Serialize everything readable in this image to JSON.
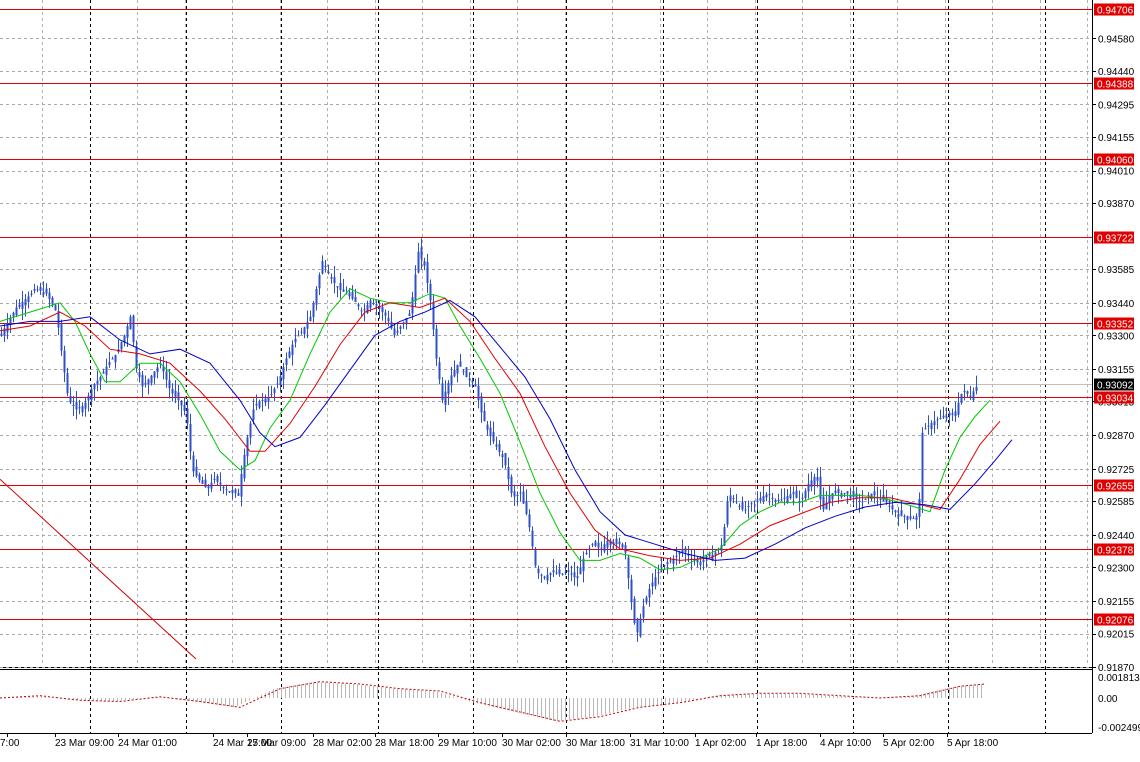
{
  "chart_data": {
    "type": "candlestick",
    "main_panel": {
      "ylim": [
        0.91875,
        0.94745
      ],
      "price_ticks": [
        "0.94580",
        "0.94440",
        "0.94295",
        "0.94155",
        "0.94010",
        "0.93870",
        "0.93585",
        "0.93440",
        "0.93300",
        "0.93155",
        "0.93015",
        "0.92870",
        "0.92725",
        "0.92585",
        "0.92440",
        "0.92300",
        "0.92155",
        "0.92015",
        "0.91870"
      ],
      "horizontal_levels": [
        {
          "value": 0.94706,
          "label": "0.94706"
        },
        {
          "value": 0.94388,
          "label": "0.94388"
        },
        {
          "value": 0.9406,
          "label": "0.94060"
        },
        {
          "value": 0.93722,
          "label": "0.93722"
        },
        {
          "value": 0.93352,
          "label": "0.93352"
        },
        {
          "value": 0.93034,
          "label": "0.93034"
        },
        {
          "value": 0.92655,
          "label": "0.92655"
        },
        {
          "value": 0.92378,
          "label": "0.92378"
        },
        {
          "value": 0.92076,
          "label": "0.92076"
        }
      ],
      "current_price": {
        "value": 0.93092,
        "label": "0.93092"
      },
      "close_path": [
        [
          0,
          0.933
        ],
        [
          8,
          0.9336
        ],
        [
          16,
          0.9342
        ],
        [
          26,
          0.9346
        ],
        [
          36,
          0.935
        ],
        [
          46,
          0.9348
        ],
        [
          56,
          0.934
        ],
        [
          62,
          0.932
        ],
        [
          68,
          0.9302
        ],
        [
          76,
          0.9298
        ],
        [
          84,
          0.93
        ],
        [
          92,
          0.9308
        ],
        [
          100,
          0.9312
        ],
        [
          108,
          0.9318
        ],
        [
          116,
          0.9322
        ],
        [
          124,
          0.933
        ],
        [
          130,
          0.9338
        ],
        [
          136,
          0.9316
        ],
        [
          142,
          0.9308
        ],
        [
          150,
          0.9312
        ],
        [
          160,
          0.9318
        ],
        [
          170,
          0.9306
        ],
        [
          178,
          0.9302
        ],
        [
          186,
          0.9296
        ],
        [
          192,
          0.9272
        ],
        [
          198,
          0.9268
        ],
        [
          206,
          0.9264
        ],
        [
          214,
          0.9268
        ],
        [
          222,
          0.9265
        ],
        [
          230,
          0.9262
        ],
        [
          238,
          0.9262
        ],
        [
          246,
          0.9284
        ],
        [
          254,
          0.93
        ],
        [
          262,
          0.9302
        ],
        [
          270,
          0.9304
        ],
        [
          278,
          0.931
        ],
        [
          286,
          0.932
        ],
        [
          294,
          0.9328
        ],
        [
          302,
          0.9332
        ],
        [
          310,
          0.9338
        ],
        [
          316,
          0.935
        ],
        [
          322,
          0.9362
        ],
        [
          330,
          0.9355
        ],
        [
          338,
          0.935
        ],
        [
          346,
          0.9348
        ],
        [
          354,
          0.9345
        ],
        [
          362,
          0.934
        ],
        [
          370,
          0.9345
        ],
        [
          378,
          0.9342
        ],
        [
          386,
          0.9338
        ],
        [
          394,
          0.933
        ],
        [
          402,
          0.9335
        ],
        [
          410,
          0.934
        ],
        [
          418,
          0.9366
        ],
        [
          424,
          0.936
        ],
        [
          430,
          0.9345
        ],
        [
          436,
          0.932
        ],
        [
          442,
          0.9302
        ],
        [
          450,
          0.9312
        ],
        [
          458,
          0.9318
        ],
        [
          466,
          0.9312
        ],
        [
          474,
          0.931
        ],
        [
          480,
          0.9298
        ],
        [
          488,
          0.9288
        ],
        [
          496,
          0.9282
        ],
        [
          504,
          0.9276
        ],
        [
          512,
          0.926
        ],
        [
          520,
          0.9262
        ],
        [
          528,
          0.925
        ],
        [
          536,
          0.9228
        ],
        [
          544,
          0.9226
        ],
        [
          552,
          0.9228
        ],
        [
          560,
          0.9227
        ],
        [
          568,
          0.9228
        ],
        [
          576,
          0.9225
        ],
        [
          584,
          0.9235
        ],
        [
          592,
          0.924
        ],
        [
          600,
          0.9238
        ],
        [
          608,
          0.9242
        ],
        [
          616,
          0.924
        ],
        [
          624,
          0.924
        ],
        [
          630,
          0.9218
        ],
        [
          636,
          0.92
        ],
        [
          642,
          0.9212
        ],
        [
          650,
          0.9222
        ],
        [
          658,
          0.9228
        ],
        [
          666,
          0.9232
        ],
        [
          674,
          0.9234
        ],
        [
          682,
          0.9238
        ],
        [
          690,
          0.9234
        ],
        [
          698,
          0.9232
        ],
        [
          706,
          0.9234
        ],
        [
          714,
          0.9236
        ],
        [
          722,
          0.924
        ],
        [
          728,
          0.9262
        ],
        [
          736,
          0.9258
        ],
        [
          744,
          0.9254
        ],
        [
          752,
          0.9258
        ],
        [
          760,
          0.926
        ],
        [
          768,
          0.9262
        ],
        [
          776,
          0.9258
        ],
        [
          784,
          0.926
        ],
        [
          792,
          0.9262
        ],
        [
          800,
          0.9258
        ],
        [
          808,
          0.9266
        ],
        [
          816,
          0.927
        ],
        [
          822,
          0.9254
        ],
        [
          830,
          0.9262
        ],
        [
          838,
          0.9262
        ],
        [
          846,
          0.9262
        ],
        [
          854,
          0.926
        ],
        [
          862,
          0.9258
        ],
        [
          870,
          0.9262
        ],
        [
          878,
          0.926
        ],
        [
          886,
          0.9258
        ],
        [
          894,
          0.9254
        ],
        [
          902,
          0.9252
        ],
        [
          910,
          0.9252
        ],
        [
          918,
          0.925
        ],
        [
          922,
          0.9288
        ],
        [
          930,
          0.9292
        ],
        [
          938,
          0.9294
        ],
        [
          946,
          0.9295
        ],
        [
          954,
          0.9296
        ],
        [
          962,
          0.9306
        ],
        [
          970,
          0.9304
        ],
        [
          978,
          0.9309
        ]
      ],
      "moving_averages": [
        {
          "color": "#00c800",
          "path": [
            [
              0,
              0.9336
            ],
            [
              30,
              0.934
            ],
            [
              60,
              0.9344
            ],
            [
              75,
              0.9336
            ],
            [
              90,
              0.9322
            ],
            [
              105,
              0.931
            ],
            [
              120,
              0.931
            ],
            [
              140,
              0.9318
            ],
            [
              160,
              0.9318
            ],
            [
              180,
              0.931
            ],
            [
              200,
              0.9296
            ],
            [
              220,
              0.928
            ],
            [
              240,
              0.9272
            ],
            [
              255,
              0.9276
            ],
            [
              270,
              0.929
            ],
            [
              290,
              0.9302
            ],
            [
              310,
              0.9322
            ],
            [
              330,
              0.934
            ],
            [
              350,
              0.935
            ],
            [
              370,
              0.9346
            ],
            [
              390,
              0.9344
            ],
            [
              410,
              0.9344
            ],
            [
              430,
              0.9348
            ],
            [
              445,
              0.9346
            ],
            [
              460,
              0.9334
            ],
            [
              480,
              0.932
            ],
            [
              500,
              0.9305
            ],
            [
              520,
              0.9284
            ],
            [
              540,
              0.9262
            ],
            [
              560,
              0.9245
            ],
            [
              580,
              0.9233
            ],
            [
              600,
              0.9233
            ],
            [
              620,
              0.9236
            ],
            [
              640,
              0.9234
            ],
            [
              660,
              0.9229
            ],
            [
              680,
              0.923
            ],
            [
              700,
              0.9234
            ],
            [
              720,
              0.9238
            ],
            [
              740,
              0.9248
            ],
            [
              760,
              0.9254
            ],
            [
              780,
              0.9258
            ],
            [
              800,
              0.9258
            ],
            [
              820,
              0.9261
            ],
            [
              840,
              0.9261
            ],
            [
              860,
              0.9261
            ],
            [
              880,
              0.926
            ],
            [
              900,
              0.9258
            ],
            [
              915,
              0.9256
            ],
            [
              930,
              0.9254
            ],
            [
              945,
              0.9272
            ],
            [
              960,
              0.9286
            ],
            [
              975,
              0.9295
            ],
            [
              990,
              0.9302
            ]
          ]
        },
        {
          "color": "#e00000",
          "path": [
            [
              0,
              0.9332
            ],
            [
              30,
              0.9334
            ],
            [
              60,
              0.934
            ],
            [
              85,
              0.9334
            ],
            [
              110,
              0.9324
            ],
            [
              140,
              0.9322
            ],
            [
              170,
              0.9318
            ],
            [
              200,
              0.9306
            ],
            [
              225,
              0.9294
            ],
            [
              250,
              0.928
            ],
            [
              265,
              0.928
            ],
            [
              290,
              0.9292
            ],
            [
              315,
              0.9308
            ],
            [
              340,
              0.9326
            ],
            [
              365,
              0.934
            ],
            [
              390,
              0.9344
            ],
            [
              420,
              0.9342
            ],
            [
              445,
              0.9346
            ],
            [
              470,
              0.9336
            ],
            [
              495,
              0.932
            ],
            [
              520,
              0.9305
            ],
            [
              545,
              0.9282
            ],
            [
              570,
              0.9262
            ],
            [
              595,
              0.9246
            ],
            [
              620,
              0.9238
            ],
            [
              650,
              0.9235
            ],
            [
              680,
              0.9233
            ],
            [
              710,
              0.9234
            ],
            [
              740,
              0.924
            ],
            [
              770,
              0.9248
            ],
            [
              800,
              0.9253
            ],
            [
              830,
              0.9258
            ],
            [
              860,
              0.926
            ],
            [
              890,
              0.926
            ],
            [
              920,
              0.9257
            ],
            [
              940,
              0.9255
            ],
            [
              960,
              0.9268
            ],
            [
              980,
              0.9283
            ],
            [
              1000,
              0.9293
            ]
          ]
        },
        {
          "color": "#0000c8",
          "path": [
            [
              0,
              0.9334
            ],
            [
              30,
              0.9336
            ],
            [
              60,
              0.9336
            ],
            [
              90,
              0.9338
            ],
            [
              120,
              0.9328
            ],
            [
              150,
              0.9322
            ],
            [
              180,
              0.9324
            ],
            [
              210,
              0.9318
            ],
            [
              240,
              0.9302
            ],
            [
              260,
              0.9288
            ],
            [
              275,
              0.9282
            ],
            [
              300,
              0.9286
            ],
            [
              325,
              0.93
            ],
            [
              350,
              0.9315
            ],
            [
              375,
              0.933
            ],
            [
              400,
              0.9336
            ],
            [
              425,
              0.934
            ],
            [
              450,
              0.9345
            ],
            [
              475,
              0.9338
            ],
            [
              500,
              0.9325
            ],
            [
              525,
              0.9312
            ],
            [
              550,
              0.9294
            ],
            [
              575,
              0.9272
            ],
            [
              600,
              0.9254
            ],
            [
              625,
              0.9244
            ],
            [
              655,
              0.924
            ],
            [
              685,
              0.9236
            ],
            [
              715,
              0.9233
            ],
            [
              745,
              0.9234
            ],
            [
              775,
              0.924
            ],
            [
              805,
              0.9247
            ],
            [
              835,
              0.9252
            ],
            [
              865,
              0.9256
            ],
            [
              895,
              0.9258
            ],
            [
              925,
              0.9257
            ],
            [
              950,
              0.9255
            ],
            [
              975,
              0.9266
            ],
            [
              995,
              0.9276
            ],
            [
              1012,
              0.9285
            ]
          ]
        }
      ],
      "trendline": {
        "color": "#d00000",
        "from": [
          0,
          0.9268
        ],
        "to": [
          196,
          0.91905
        ]
      }
    },
    "oscillator": {
      "ylim": [
        -0.003,
        0.0024
      ],
      "ticks": [
        "0.001813",
        "0.00",
        "-0.002499"
      ],
      "signal_path": [
        [
          0,
          0.0
        ],
        [
          40,
          0.0002
        ],
        [
          80,
          -0.0002
        ],
        [
          120,
          -0.0003
        ],
        [
          160,
          0.0001
        ],
        [
          200,
          -0.0003
        ],
        [
          240,
          -0.0008
        ],
        [
          280,
          0.0008
        ],
        [
          320,
          0.0014
        ],
        [
          360,
          0.0012
        ],
        [
          400,
          0.0008
        ],
        [
          440,
          0.0006
        ],
        [
          480,
          -0.0004
        ],
        [
          520,
          -0.0012
        ],
        [
          560,
          -0.002
        ],
        [
          600,
          -0.0016
        ],
        [
          640,
          -0.0008
        ],
        [
          680,
          -0.0004
        ],
        [
          720,
          0.0002
        ],
        [
          760,
          0.0004
        ],
        [
          800,
          0.0004
        ],
        [
          840,
          0.0002
        ],
        [
          880,
          0.0
        ],
        [
          920,
          0.0002
        ],
        [
          960,
          0.001
        ],
        [
          985,
          0.0012
        ]
      ]
    },
    "x_tick_labels": [
      "7:00",
      "23 Mar 09:00",
      "24 Mar 01:00",
      "24 Mar 17:00",
      "25 Mar 09:00",
      "28 Mar 02:00",
      "28 Mar 18:00",
      "29 Mar 10:00",
      "30 Mar 02:00",
      "30 Mar 18:00",
      "31 Mar 10:00",
      "1 Apr 02:00",
      "1 Apr 18:00",
      "4 Apr 10:00",
      "5 Apr 02:00",
      "5 Apr 18:00"
    ],
    "grid": true,
    "colors": {
      "candle": "#3050c8",
      "level_line": "#e00000",
      "label_bg": "#e00000",
      "label_text": "#ffffff",
      "current_bg": "#000000",
      "grid": "#a0a0a0",
      "divider": "#000000"
    }
  }
}
